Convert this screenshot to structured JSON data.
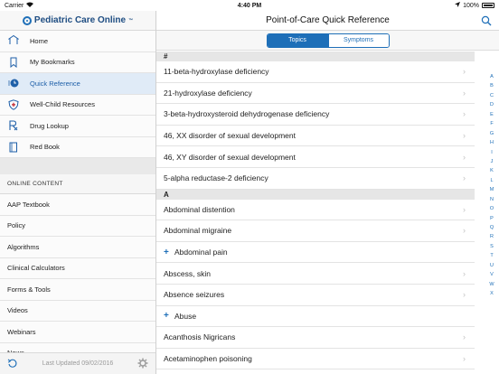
{
  "status_bar": {
    "carrier": "Carrier",
    "time": "4:40 PM",
    "battery": "100%"
  },
  "sidebar": {
    "brand": "Pediatric Care Online",
    "brand_mark": "™",
    "nav": [
      {
        "label": "Home",
        "icon": "home-icon"
      },
      {
        "label": "My Bookmarks",
        "icon": "bookmark-icon"
      },
      {
        "label": "Quick Reference",
        "icon": "clock-icon",
        "active": true
      },
      {
        "label": "Well-Child Resources",
        "icon": "shield-plus-icon"
      },
      {
        "label": "Drug Lookup",
        "icon": "rx-icon"
      },
      {
        "label": "Red Book",
        "icon": "book-icon"
      }
    ],
    "section_title": "ONLINE CONTENT",
    "content_items": [
      "AAP Textbook",
      "Policy",
      "Algorithms",
      "Clinical Calculators",
      "Forms & Tools",
      "Videos",
      "Webinars",
      "News"
    ],
    "footer": {
      "last_updated": "Last Updated 09/02/2016"
    }
  },
  "main": {
    "title": "Point-of-Care Quick Reference",
    "segments": [
      {
        "label": "Topics",
        "selected": true
      },
      {
        "label": "Symptoms",
        "selected": false
      }
    ],
    "groups": [
      {
        "header": "#",
        "rows": [
          {
            "label": "11-beta-hydroxylase deficiency",
            "expandable": false
          },
          {
            "label": "21-hydroxylase deficiency",
            "expandable": false
          },
          {
            "label": "3-beta-hydroxysteroid dehydrogenase deficiency",
            "expandable": false
          },
          {
            "label": "46, XX disorder of sexual development",
            "expandable": false
          },
          {
            "label": "46, XY disorder of sexual development",
            "expandable": false
          },
          {
            "label": "5-alpha reductase-2 deficiency",
            "expandable": false
          }
        ]
      },
      {
        "header": "A",
        "rows": [
          {
            "label": "Abdominal distention",
            "expandable": false
          },
          {
            "label": "Abdominal migraine",
            "expandable": false
          },
          {
            "label": "Abdominal pain",
            "expandable": true
          },
          {
            "label": "Abscess, skin",
            "expandable": false
          },
          {
            "label": "Absence seizures",
            "expandable": false
          },
          {
            "label": "Abuse",
            "expandable": true
          },
          {
            "label": "Acanthosis Nigricans",
            "expandable": false
          },
          {
            "label": "Acetaminophen poisoning",
            "expandable": false
          }
        ]
      }
    ],
    "index_letters": [
      "A",
      "B",
      "C",
      "D",
      "E",
      "F",
      "G",
      "H",
      "I",
      "J",
      "K",
      "L",
      "M",
      "N",
      "O",
      "P",
      "Q",
      "R",
      "S",
      "T",
      "U",
      "V",
      "W",
      "X"
    ]
  },
  "colors": {
    "accent": "#1e6fb8",
    "brand": "#1e4d82",
    "active_bg": "#e0ebf7"
  }
}
